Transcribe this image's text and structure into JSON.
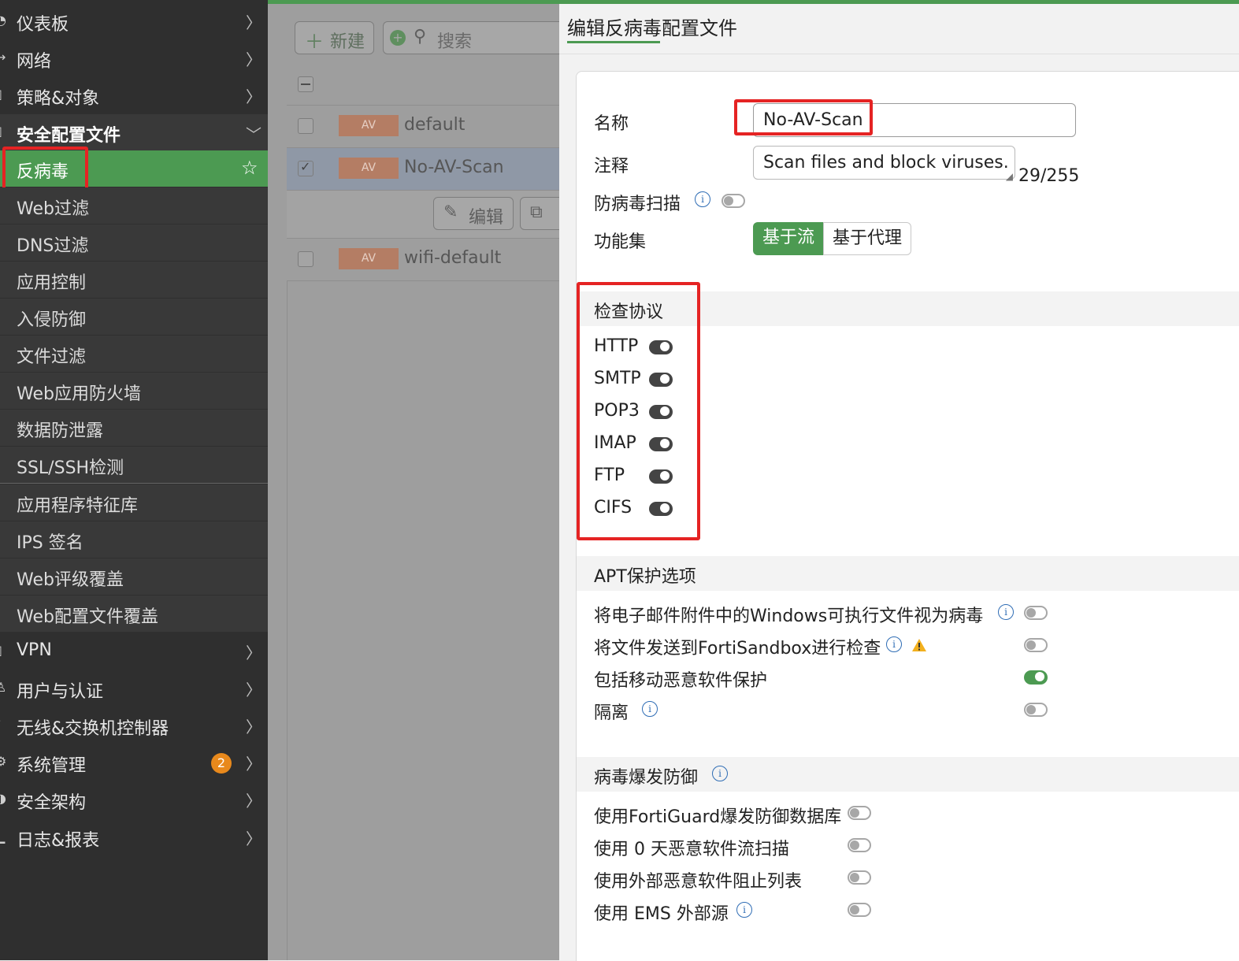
{
  "sidebar": {
    "items": [
      {
        "label": "仪表板",
        "icon": "dashboard-icon"
      },
      {
        "label": "网络",
        "icon": "network-icon"
      },
      {
        "label": "策略&对象",
        "icon": "policy-icon"
      },
      {
        "label": "安全配置文件",
        "icon": "security-profile-icon"
      }
    ],
    "sub_items": [
      "反病毒",
      "Web过滤",
      "DNS过滤",
      "应用控制",
      "入侵防御",
      "文件过滤",
      "Web应用防火墙",
      "数据防泄露",
      "SSL/SSH检测",
      "应用程序特征库",
      "IPS 签名",
      "Web评级覆盖",
      "Web配置文件覆盖"
    ],
    "lower_items": [
      {
        "label": "VPN",
        "icon": "vpn-icon"
      },
      {
        "label": "用户与认证",
        "icon": "user-icon"
      },
      {
        "label": "无线&交换机控制器",
        "icon": "wifi-icon"
      },
      {
        "label": "系统管理",
        "icon": "system-icon",
        "badge": "2"
      },
      {
        "label": "安全架构",
        "icon": "fabric-icon"
      },
      {
        "label": "日志&报表",
        "icon": "log-icon"
      }
    ]
  },
  "list": {
    "new_label": "新建",
    "search_placeholder": "搜索",
    "rows": [
      {
        "tag": "AV",
        "name": "default"
      },
      {
        "tag": "AV",
        "name": "No-AV-Scan"
      },
      {
        "tag": "AV",
        "name": "wifi-default"
      }
    ],
    "edit_label": "编辑"
  },
  "dialog": {
    "title": "编辑反病毒配置文件",
    "name_label": "名称",
    "name_value": "No-AV-Scan",
    "comment_label": "注释",
    "comment_value": "Scan files and block viruses.",
    "comment_count": "29/255",
    "av_scan_label": "防病毒扫描",
    "feature_set_label": "功能集",
    "feature_flow": "基于流",
    "feature_proxy": "基于代理",
    "inspect_title": "检查协议",
    "protocols": [
      "HTTP",
      "SMTP",
      "POP3",
      "IMAP",
      "FTP",
      "CIFS"
    ],
    "apt_title": "APT保护选项",
    "apt_options": [
      {
        "label": "将电子邮件附件中的Windows可执行文件视为病毒",
        "on": false
      },
      {
        "label": "将文件发送到FortiSandbox进行检查",
        "on": false
      },
      {
        "label": "包括移动恶意软件保护",
        "on": true
      },
      {
        "label": "隔离",
        "on": false
      }
    ],
    "outbreak_title": "病毒爆发防御",
    "outbreak_options": [
      {
        "label": "使用FortiGuard爆发防御数据库",
        "on": false
      },
      {
        "label": "使用 0 天恶意软件流扫描",
        "on": false
      },
      {
        "label": "使用外部恶意软件阻止列表",
        "on": false
      },
      {
        "label": "使用 EMS 外部源",
        "on": false
      }
    ]
  },
  "colors": {
    "accent_green": "#4c9a52",
    "highlight_red": "#e52323",
    "badge_orange": "#e8891c",
    "sidebar_bg": "#2f2f2f"
  }
}
